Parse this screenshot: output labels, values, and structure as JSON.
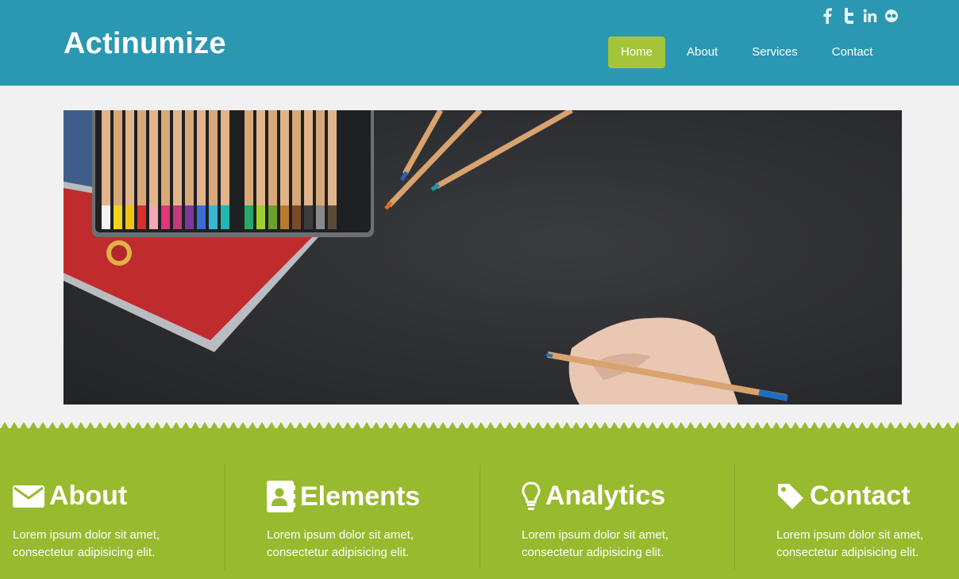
{
  "header": {
    "logo": "Actinumize",
    "bg_color": "#2b98b2",
    "social": [
      {
        "name": "facebook-icon",
        "glyph": "f"
      },
      {
        "name": "twitter-icon",
        "glyph": "t"
      },
      {
        "name": "linkedin-icon",
        "glyph": "in"
      },
      {
        "name": "flickr-icon",
        "glyph": "flickr"
      }
    ]
  },
  "nav": {
    "items": [
      {
        "label": "Home",
        "active": true
      },
      {
        "label": "About",
        "active": false
      },
      {
        "label": "Services",
        "active": false
      },
      {
        "label": "Contact",
        "active": false
      }
    ],
    "active_color": "#a4c43a"
  },
  "hero": {
    "description": "colored pencils tin and hand holding pencil on dark desk"
  },
  "features": {
    "bg_color": "#98ba2f",
    "items": [
      {
        "title": "About",
        "icon": "envelope-icon",
        "text": "Lorem ipsum dolor sit amet, consectetur adipisicing elit."
      },
      {
        "title": "Elements",
        "icon": "address-book-icon",
        "text": "Lorem ipsum dolor sit amet, consectetur adipisicing elit."
      },
      {
        "title": "Analytics",
        "icon": "lightbulb-icon",
        "text": "Lorem ipsum dolor sit amet, consectetur adipisicing elit."
      },
      {
        "title": "Contact",
        "icon": "tag-icon",
        "text": "Lorem ipsum dolor sit amet, consectetur adipisicing elit."
      }
    ]
  }
}
